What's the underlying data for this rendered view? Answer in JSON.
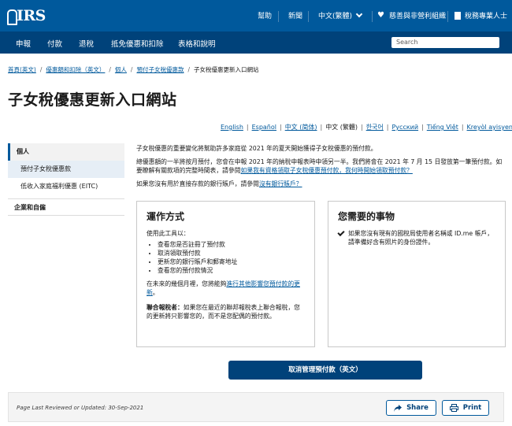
{
  "header": {
    "logo_text": "IRS",
    "links": {
      "help": "幫助",
      "news": "新聞",
      "language": "中文(繁體)",
      "charities": "慈善與非營利組織",
      "tax_pros": "稅務專業人士"
    }
  },
  "mainnav": {
    "items": [
      "申報",
      "付款",
      "退稅",
      "抵免優惠和扣除",
      "表格和說明"
    ],
    "search_placeholder": "Search"
  },
  "breadcrumb": [
    "首頁(英文)",
    "優惠額和扣除（英文）",
    "個人",
    "預付子女稅優惠款",
    "子女稅優惠更新入口網站"
  ],
  "page_title": "子女稅優惠更新入口網站",
  "languages": [
    {
      "label": "English",
      "current": false
    },
    {
      "label": "Español",
      "current": false
    },
    {
      "label": "中文 (简体)",
      "current": false
    },
    {
      "label": "中文 (繁體)",
      "current": true
    },
    {
      "label": "한국어",
      "current": false
    },
    {
      "label": "Русский",
      "current": false
    },
    {
      "label": "Tiếng Việt",
      "current": false
    },
    {
      "label": "Kreyòl ayisyen",
      "current": false
    }
  ],
  "sidebar": {
    "personal": "個人",
    "child_credit": "預付子女稅優惠款",
    "eitc": "低收入家庭福利優惠 (EITC)",
    "business": "企業和自僱"
  },
  "content": {
    "p1": "子女稅優惠的重要變化將幫助許多家庭從 2021 年的夏天開始獲得子女稅優惠的預付款。",
    "p2_text": "總優惠額的一半將按月預付，您會在申報 2021 年的納稅申報表時申領另一半。我們將會在 2021 年 7 月 15 日發放第一筆預付款。如要瞭解有關款項的完整時間表，請參閱",
    "p2_link": "如果我有資格領取子女稅優惠預付款，我何時開始領取預付款？",
    "p3_text": "如果您沒有用於直接存款的銀行賬戶，請參閱",
    "p3_link": "沒有銀行賬戶？"
  },
  "how_it_works": {
    "title": "運作方式",
    "intro": "使用此工具以：",
    "bullets": [
      "查看您是否註冊了預付款",
      "取消領取預付款",
      "更新您的銀行賬戶和郵寄地址",
      "查看您的預付款情況"
    ],
    "future_text": "在未來的幾個月裡，您將能夠",
    "future_link": "進行其他影響您預付款的更新",
    "future_end": "。",
    "joint_label": "聯合報稅者：",
    "joint_text": "如果您在最近的聯邦報稅表上聯合報稅，您的更新將只影響您的，而不是您配偶的預付款。"
  },
  "what_you_need": {
    "title": "您需要的事物",
    "item": "如果您沒有現有的國稅局使用者名稱或 ID.me 帳戶，請準備好含有照片的身份證件。"
  },
  "primary_button": "取消管理預付款（英文）",
  "footer": {
    "last_reviewed": "Page Last Reviewed or Updated: 30-Sep-2021",
    "share": "Share",
    "print": "Print"
  },
  "colors": {
    "top_bar": "#00599c",
    "main_nav": "#00427a",
    "link": "#00599c"
  }
}
